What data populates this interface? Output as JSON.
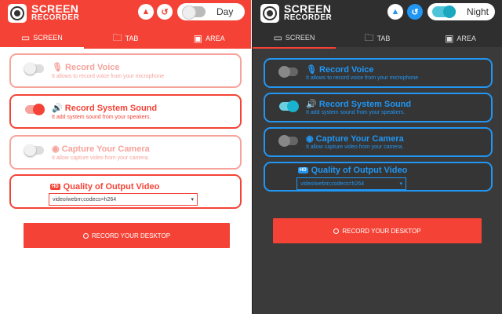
{
  "app": {
    "logo_line1": "SCREEN",
    "logo_line2": "RECORDER"
  },
  "light": {
    "theme_label": "Day",
    "tabs": [
      {
        "label": "SCREEN",
        "icon": "monitor-icon"
      },
      {
        "label": "TAB",
        "icon": "folder-icon"
      },
      {
        "label": "AREA",
        "icon": "area-icon"
      }
    ],
    "options": [
      {
        "title": "Record Voice",
        "desc": "It allows to record voice from your microphone",
        "enabled": false,
        "icon": "microphone-icon"
      },
      {
        "title": "Record System Sound",
        "desc": "It add system sound from your speakers.",
        "enabled": true,
        "icon": "speaker-icon"
      },
      {
        "title": "Capture Your Camera",
        "desc": "It allow capture video from your camera.",
        "enabled": false,
        "icon": "camera-icon"
      }
    ],
    "quality_title": "Quality of Output Video",
    "quality_badge": "HD",
    "codec_value": "video/webm;codecs=h264",
    "record_button": "RECORD YOUR DESKTOP"
  },
  "dark": {
    "theme_label": "Night",
    "tabs": [
      {
        "label": "SCREEN",
        "icon": "monitor-icon"
      },
      {
        "label": "TAB",
        "icon": "folder-icon"
      },
      {
        "label": "AREA",
        "icon": "area-icon"
      }
    ],
    "options": [
      {
        "title": "Record Voice",
        "desc": "It allows to record voice from your microphone",
        "enabled": false,
        "icon": "microphone-icon"
      },
      {
        "title": "Record System Sound",
        "desc": "It add system sound from your speakers.",
        "enabled": true,
        "icon": "speaker-icon"
      },
      {
        "title": "Capture Your Camera",
        "desc": "It allow capture video from your camera.",
        "enabled": false,
        "icon": "camera-icon"
      }
    ],
    "quality_title": "Quality of Output Video",
    "quality_badge": "HD",
    "codec_value": "video/webm;codecs=h264",
    "record_button": "RECORD YOUR DESKTOP"
  },
  "colors": {
    "accent_red": "#f44336",
    "accent_blue": "#2196f3",
    "dark_bg": "#3a3a3a"
  }
}
